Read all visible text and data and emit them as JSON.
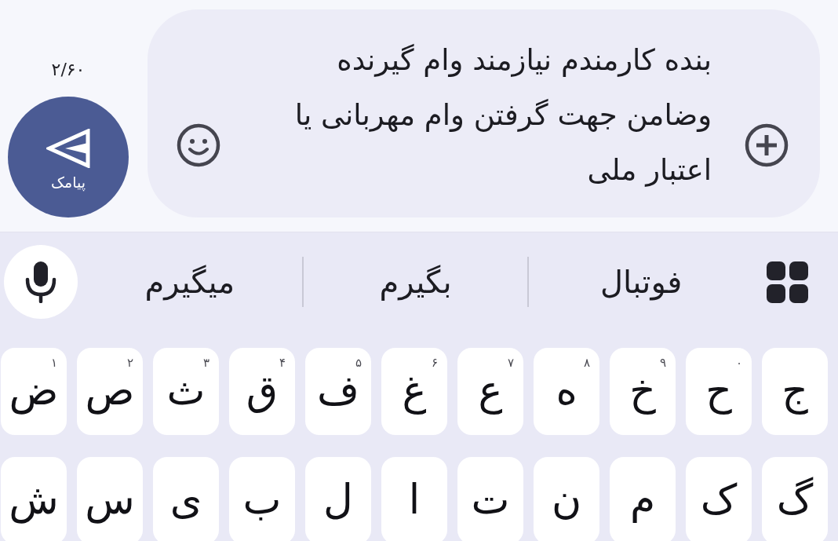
{
  "compose": {
    "counter": "۲/۶۰",
    "send_button": {
      "label": "پیامک"
    },
    "message": {
      "value": "بنده کارمندم نیازمند وام گیرنده وضامن جهت گرفتن وام مهربانی یا اعتبار ملی"
    }
  },
  "keyboard": {
    "suggestions": [
      "فوتبال",
      "بگیرم",
      "میگیرم"
    ],
    "rows": [
      [
        {
          "key": "ج"
        },
        {
          "key": "ح",
          "hint": "۰"
        },
        {
          "key": "خ",
          "hint": "۹"
        },
        {
          "key": "ه",
          "hint": "۸"
        },
        {
          "key": "ع",
          "hint": "۷"
        },
        {
          "key": "غ",
          "hint": "۶"
        },
        {
          "key": "ف",
          "hint": "۵"
        },
        {
          "key": "ق",
          "hint": "۴"
        },
        {
          "key": "ث",
          "hint": "۳"
        },
        {
          "key": "ص",
          "hint": "۲"
        },
        {
          "key": "ض",
          "hint": "۱"
        }
      ],
      [
        {
          "key": "گ"
        },
        {
          "key": "ک"
        },
        {
          "key": "م"
        },
        {
          "key": "ن"
        },
        {
          "key": "ت"
        },
        {
          "key": "ا"
        },
        {
          "key": "ل"
        },
        {
          "key": "ب"
        },
        {
          "key": "ی"
        },
        {
          "key": "س"
        },
        {
          "key": "ش"
        }
      ]
    ]
  }
}
